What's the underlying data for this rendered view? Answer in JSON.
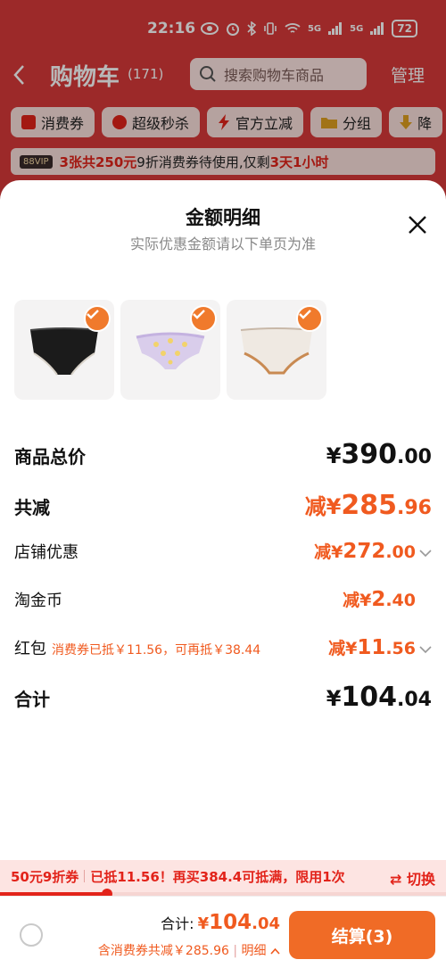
{
  "status_bar": {
    "time": "22:16",
    "network": "5G",
    "battery": "72"
  },
  "header": {
    "back_icon": "chevron-left-icon",
    "title": "购物车",
    "count": "(171)",
    "search_placeholder": "搜索购物车商品",
    "manage": "管理"
  },
  "filters": [
    {
      "icon": "coupon-icon",
      "label": "消费券",
      "color": "#e2231a"
    },
    {
      "icon": "flash-sale-icon",
      "label": "超级秒杀",
      "color": "#e2231a"
    },
    {
      "icon": "lightning-icon",
      "label": "官方立减",
      "color": "#e2231a"
    },
    {
      "icon": "folder-icon",
      "label": "分组",
      "color": "#e0a020"
    },
    {
      "icon": "price-down-icon",
      "label": "降",
      "color": "#e0a020"
    }
  ],
  "notice": {
    "badge": "88VIP",
    "highlight1": "3张共250元",
    "text1": "9折消费券待使用,仅剩",
    "highlight2": "3天1小时"
  },
  "sheet": {
    "title": "金额明细",
    "subtitle": "实际优惠金额请以下单页为准",
    "close_icon": "close-icon"
  },
  "products": [
    {
      "name": "black-briefs",
      "selected": true
    },
    {
      "name": "lavender-lace-briefs",
      "selected": true
    },
    {
      "name": "beige-briefs",
      "selected": true
    }
  ],
  "breakdown": {
    "subtotal": {
      "label": "商品总价",
      "yen": "¥",
      "int": "390",
      "dec": ".00"
    },
    "total_discount": {
      "label": "共减",
      "prefix": "减¥",
      "int": "285",
      "dec": ".96"
    },
    "store_discount": {
      "label": "店铺优惠",
      "prefix": "减¥",
      "int": "272",
      "dec": ".00"
    },
    "coins": {
      "label": "淘金币",
      "prefix": "减¥",
      "int": "2",
      "dec": ".40"
    },
    "red_packet": {
      "label": "红包",
      "note": "消费券已抵￥11.56，可再抵￥38.44",
      "prefix": "减¥",
      "int": "11",
      "dec": ".56"
    },
    "total": {
      "label": "合计",
      "yen": "¥",
      "int": "104",
      "dec": ".04"
    }
  },
  "promo": {
    "coupon": "50元9折券",
    "text": "已抵11.56！再买384.4可抵满，限用1次",
    "switch": "⇄ 切换",
    "progress": 0.24
  },
  "checkout": {
    "total_label": "合计:",
    "total_yen": "¥",
    "total_int": "104",
    "total_dec": ".04",
    "discount_text": "含消费券共减￥285.96",
    "detail": "明细",
    "pay_button": "结算(3)"
  }
}
